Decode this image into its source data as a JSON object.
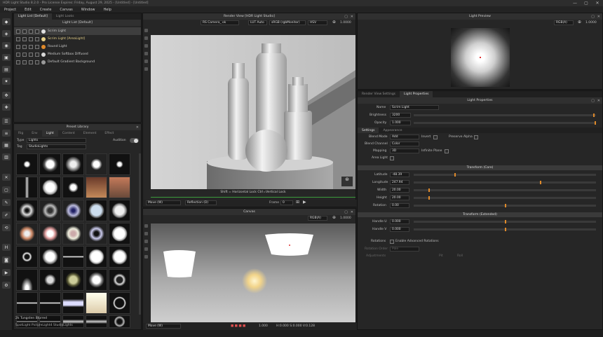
{
  "window": {
    "title": "HDR Light Studio 8.2.0 - Pro License Expires: Friday, August 29, 2025 - [Untitled] - [Untitled]",
    "controls": [
      "—",
      "▢",
      "✕"
    ]
  },
  "menu": [
    "Project",
    "Edit",
    "Create",
    "Canvas",
    "Window",
    "Help"
  ],
  "light_list": {
    "tabs": [
      "Light List [Default]",
      "Light Looks"
    ],
    "header": "Light List [Default]",
    "items": [
      {
        "name": "Scrim Light",
        "selected": true,
        "color": "#e0e0e0"
      },
      {
        "name": "Scrim Light [AreaLight]",
        "selected": false,
        "color": "#e8d28a",
        "highlight": true
      },
      {
        "name": "Round Light",
        "selected": false,
        "color": "#e08a2a"
      },
      {
        "name": "Medium Softbox Diffused",
        "selected": false,
        "color": "#d8d8d8"
      },
      {
        "name": "Default Gradient Background",
        "selected": false,
        "color": "#9a9a9a"
      }
    ]
  },
  "preset_library": {
    "header": "Preset Library",
    "tabs": [
      "Rig",
      "Env",
      "Light",
      "Content",
      "Element",
      "Effect"
    ],
    "type_label": "Type",
    "type_value": "Lights",
    "tag_label": "Tag",
    "tag_value": "StudioLights",
    "audition_label": "Audition",
    "selected_name": "2k Tungsten Blurred",
    "footer_path": "SpotLight PictureLight4 StudioLights"
  },
  "render_view": {
    "header": "Render View [HDR Light Studio]",
    "camera": "RS Camera_ ok",
    "lut": "LUT Auto",
    "colorspace": "sRGB (rgbMonitor)",
    "mode": "HSV",
    "zoom": "1.0000",
    "hint": "Shift = Horizontal Lock  Ctrl=Vertical Lock",
    "tool": "Move (W)",
    "reflection": "Reflection (D)",
    "frame_label": "Frame",
    "frame_value": "0"
  },
  "canvas": {
    "header": "Canvas",
    "channel": "RGB(A)",
    "zoom": "1.0000",
    "tool": "Move (W)",
    "status_value": "1.000",
    "coords": "H:0.000 S:0.000 V:0.128"
  },
  "light_preview": {
    "header": "Light Preview",
    "channel": "RGB(A)",
    "zoom": "1.0000"
  },
  "properties": {
    "tabs": [
      "Render View Settings",
      "Light Properties"
    ],
    "header": "Light Properties",
    "name_label": "Name",
    "name_value": "Scrim Light",
    "brightness_label": "Brightness",
    "brightness_value": "3200",
    "opacity_label": "Opacity",
    "opacity_value": "1.000",
    "sub_tabs": [
      "Settings",
      "Appearance"
    ],
    "blend_mode_label": "Blend Mode",
    "blend_mode_value": "Add",
    "invert_label": "Invert",
    "preserve_alpha_label": "Preserve Alpha",
    "blend_channel_label": "Blend Channel",
    "blend_channel_value": "Color",
    "mapping_label": "Mapping",
    "mapping_value": "3D",
    "infinite_plane_label": "Infinite Plane",
    "area_light_label": "Area Light",
    "transform_core": "Transform (Core)",
    "latitude_label": "Latitude",
    "latitude_value": "-48.39",
    "longitude_label": "Longitude",
    "longitude_value": "247.94",
    "width_label": "Width",
    "width_value": "20.00",
    "height_label": "Height",
    "height_value": "20.00",
    "rotation_label": "Rotation",
    "rotation_value": "0.00",
    "transform_ext": "Transform (Extended)",
    "handle_u_label": "Handle U",
    "handle_u_value": "0.000",
    "handle_v_label": "Handle V",
    "handle_v_value": "0.000",
    "rotations_label": "Rotations",
    "enable_adv_label": "Enable Advanced Rotations",
    "rotation_order_label": "Rotation Order",
    "rotation_order_value": "Pole",
    "adjustments_label": "Adjustments",
    "pitch_label": "Pit",
    "roll_label": "Roll"
  },
  "colors": {
    "accent": "#e08a2a",
    "panel": "#262626",
    "header": "#303030"
  }
}
